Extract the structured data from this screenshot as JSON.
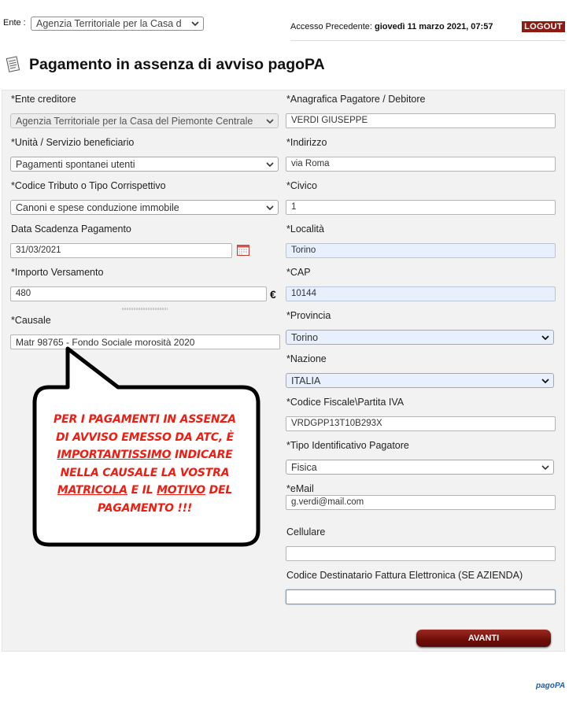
{
  "topbar": {
    "ente_label": "Ente :",
    "ente_value": "Agenzia Territoriale per la Casa d",
    "access_prefix": "Accesso Precedente:",
    "access_value": "giovedì 11 marzo 2021, 07:57",
    "logout_label": "LOGOUT"
  },
  "page": {
    "title": "Pagamento in assenza di avviso pagoPA"
  },
  "form_left": {
    "ente_creditore_label": "*Ente creditore",
    "ente_creditore_value": "Agenzia Territoriale per la Casa del Piemonte Centrale",
    "unita_label": "*Unità / Servizio beneficiario",
    "unita_value": "Pagamenti spontanei utenti",
    "tributo_label": "*Codice Tributo o Tipo Corrispettivo",
    "tributo_value": "Canoni e spese conduzione immobile",
    "scadenza_label": "Data Scadenza Pagamento",
    "scadenza_value": "31/03/2021",
    "importo_label": "*Importo Versamento",
    "importo_value": "480",
    "currency": "€",
    "causale_label": "*Causale",
    "causale_value": "Matr 98765 - Fondo Sociale morosità 2020"
  },
  "form_right": {
    "anagrafica_label": "*Anagrafica Pagatore / Debitore",
    "anagrafica_value": "VERDI GIUSEPPE",
    "indirizzo_label": "*Indirizzo",
    "indirizzo_value": "via Roma",
    "civico_label": "*Civico",
    "civico_value": "1",
    "localita_label": "*Località",
    "localita_value": "Torino",
    "cap_label": "*CAP",
    "cap_value": "10144",
    "provincia_label": "*Provincia",
    "provincia_value": "Torino",
    "nazione_label": "*Nazione",
    "nazione_value": "ITALIA",
    "cf_label": "*Codice Fiscale\\Partita IVA",
    "cf_value": "VRDGPP13T10B293X",
    "tipo_label": "*Tipo Identificativo Pagatore",
    "tipo_value": "Fisica",
    "email_label": "*eMail",
    "email_value": "g.verdi@mail.com",
    "cellulare_label": "Cellulare",
    "cellulare_value": "",
    "codice_dest_label": "Codice Destinatario Fattura Elettronica (SE AZIENDA)",
    "codice_dest_value": ""
  },
  "actions": {
    "avanti_label": "AVANTI"
  },
  "callout": {
    "line1": "PER I PAGAMENTI IN ASSENZA",
    "line2": "DI AVVISO EMESSO DA ATC, È",
    "line3_u": "IMPORTANTISSIMO",
    "line3_rest": " INDICARE",
    "line4": "NELLA CAUSALE LA VOSTRA",
    "line5_u": "MATRICOLA",
    "line5_mid": " E IL ",
    "line5_u2": "MOTIVO",
    "line5_rest": " DEL",
    "line6": "PAGAMENTO !!!"
  },
  "footer": {
    "logo_text": "pagoPA"
  },
  "colors": {
    "brand_dark_red": "#8f1a12",
    "callout_red": "#ee1d12",
    "autofill_blue": "#e8f0fe"
  }
}
